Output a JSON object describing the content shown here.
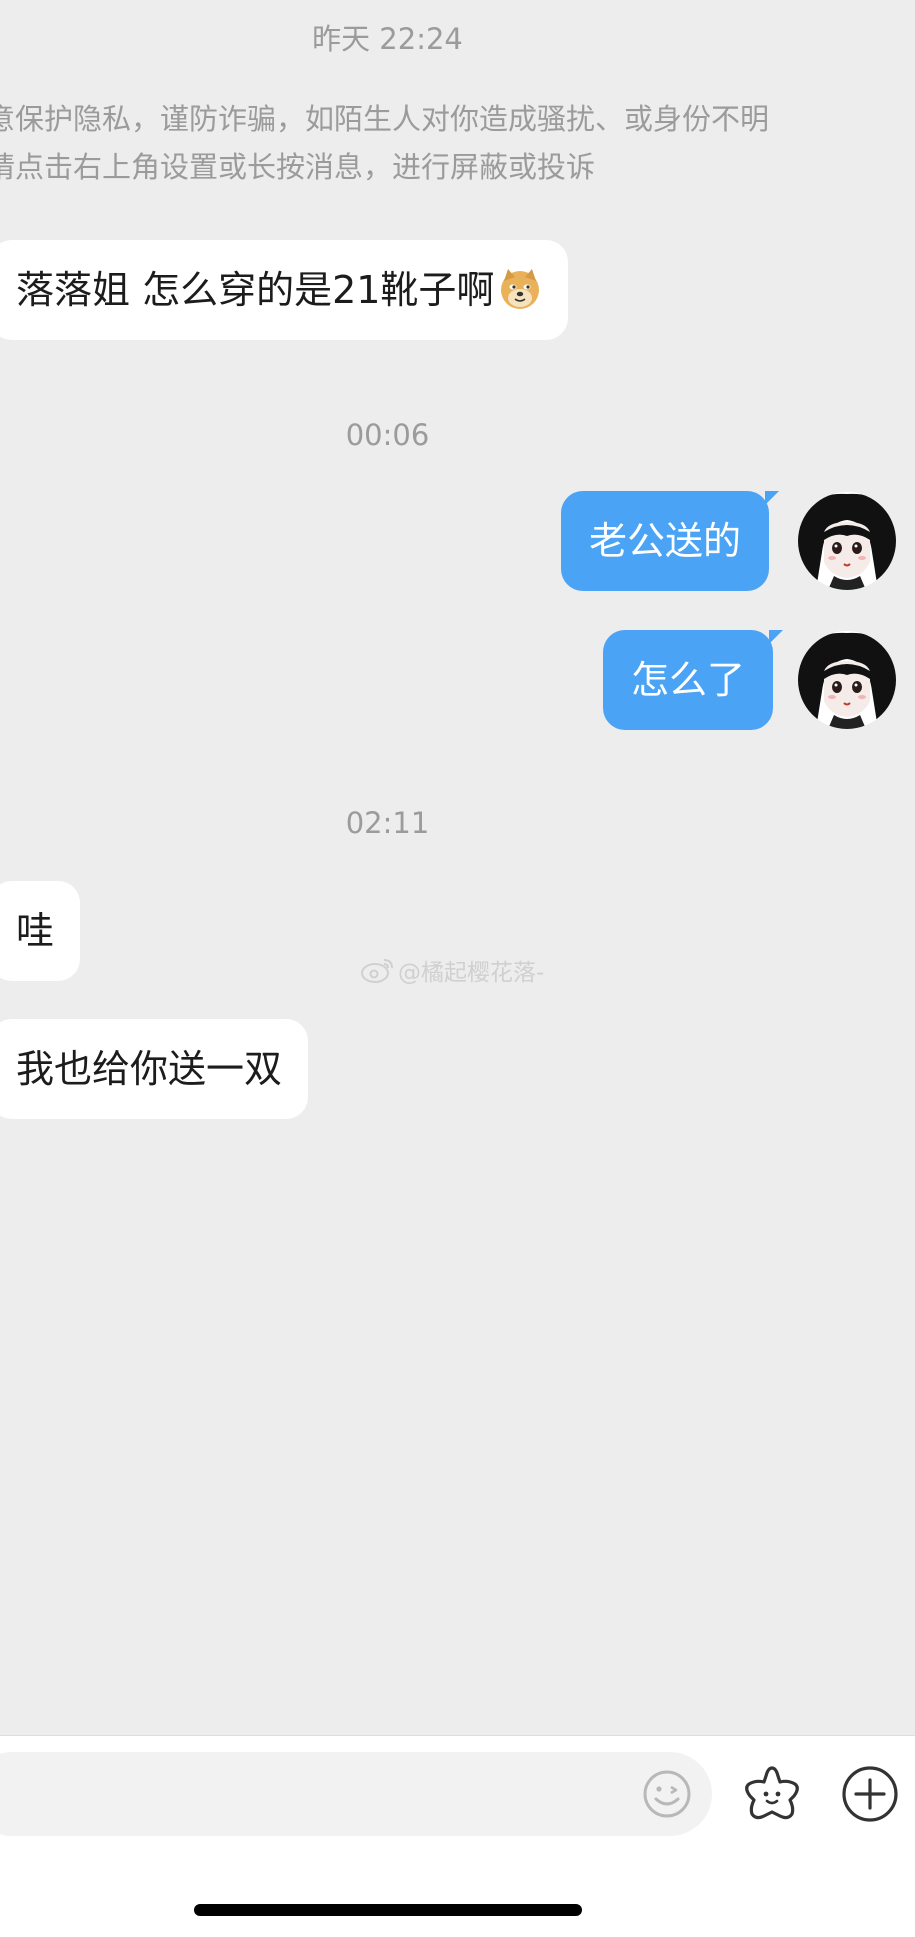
{
  "timestamps": {
    "first": "昨天 22:24",
    "second": "00:06",
    "third": "02:11"
  },
  "notice": {
    "line1": "意保护隐私，谨防诈骗，如陌生人对你造成骚扰、或身份不明",
    "line2": "请点击右上角设置或长按消息，进行屏蔽或投诉"
  },
  "messages": [
    {
      "side": "left",
      "text": "落落姐 怎么穿的是21靴子啊",
      "emoji": "doge-emoji"
    },
    {
      "side": "right",
      "text": "老公送的"
    },
    {
      "side": "right",
      "text": "怎么了"
    },
    {
      "side": "left",
      "text": "哇"
    },
    {
      "side": "left",
      "text": "我也给你送一双"
    }
  ],
  "watermark": {
    "text": "@橘起樱花落-"
  },
  "input": {
    "value": "",
    "placeholder": ""
  },
  "icons": {
    "emoji": "smiley-icon",
    "sticker": "star-face-icon",
    "more": "plus-circle-icon"
  },
  "colors": {
    "background": "#ededed",
    "right_bubble": "#4aa3f5",
    "left_bubble": "#ffffff",
    "meta_text": "#9b9b9b"
  }
}
